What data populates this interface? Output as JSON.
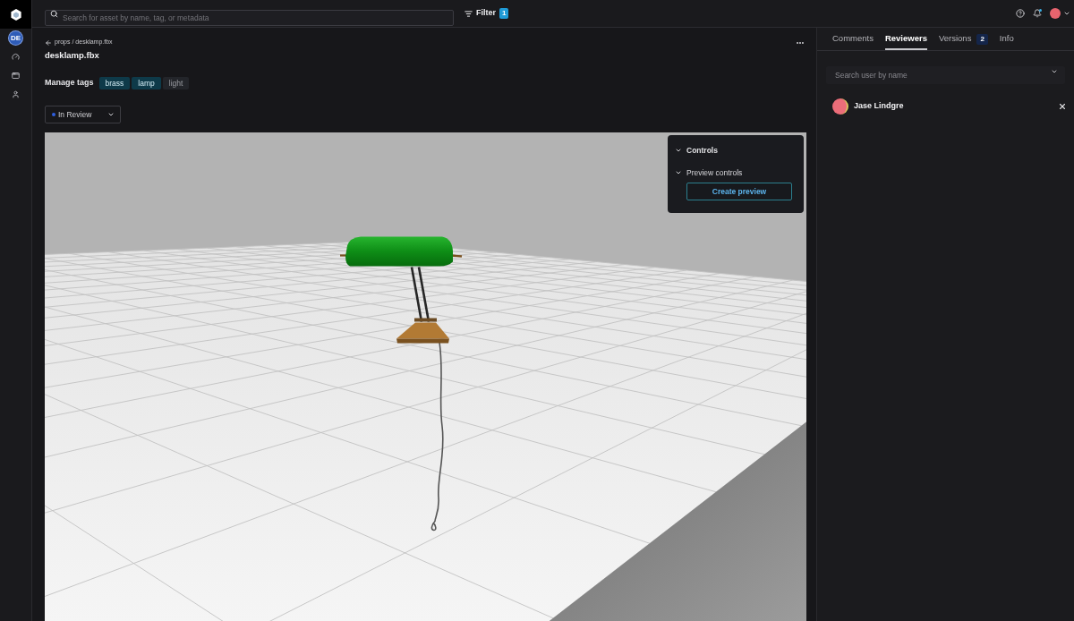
{
  "rail": {
    "workspace": "DE"
  },
  "top_bar": {
    "search": {
      "placeholder": "Search for asset by name, tag, or metadata"
    },
    "filter": {
      "label": "Filter",
      "count": "1"
    },
    "notifications": {
      "unread": true
    }
  },
  "asset": {
    "breadcrumb": "props / desklamp.fbx",
    "title": "desklamp.fbx",
    "tags_label": "Manage tags",
    "tags": [
      {
        "label": "brass",
        "selected": true
      },
      {
        "label": "lamp",
        "selected": true
      },
      {
        "label": "light",
        "selected": false
      }
    ],
    "status": "In Review"
  },
  "viewport": {
    "controls": {
      "title": "Controls",
      "expanded": true,
      "sections": [
        {
          "title": "Preview controls",
          "expanded": true,
          "button": "Create preview"
        }
      ]
    }
  },
  "side_panel": {
    "tabs": [
      {
        "label": "Comments",
        "selected": false
      },
      {
        "label": "Reviewers",
        "selected": true
      },
      {
        "label": "Versions",
        "selected": false,
        "badge": "2"
      },
      {
        "label": "Info",
        "selected": false
      }
    ],
    "search": {
      "placeholder": "Search user by name"
    },
    "reviewers": [
      {
        "name": "Jase Lindgre"
      }
    ]
  }
}
